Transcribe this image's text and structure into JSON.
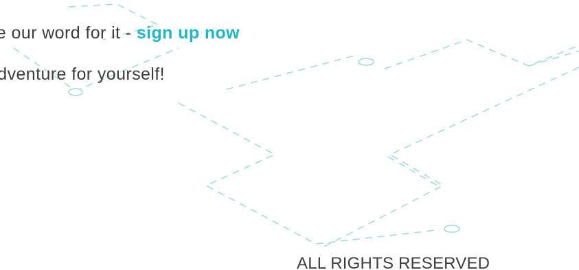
{
  "hero": {
    "line1_prefix": "ke our word for it - ",
    "cta_link": "sign up now",
    "line2": "adventure for yourself!"
  },
  "footer": {
    "rights": "ALL RIGHTS RESERVED"
  },
  "colors": {
    "accent": "#1fb7c8",
    "text": "#3d3d3d",
    "decor_lines": "#9ed9e3"
  }
}
